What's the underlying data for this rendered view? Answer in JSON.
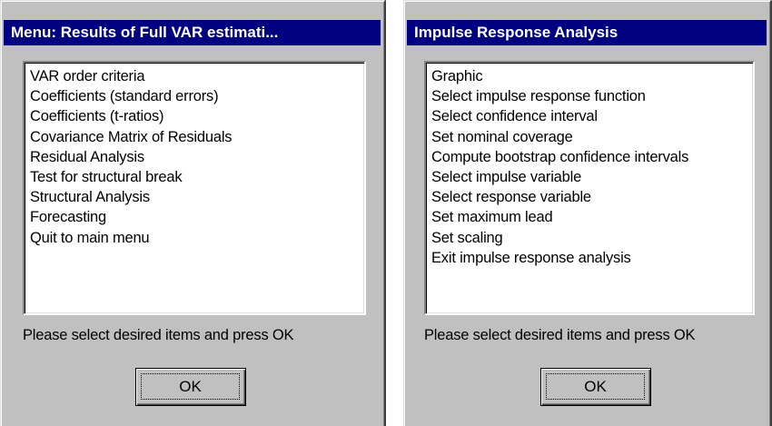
{
  "dialogs": [
    {
      "title": "Menu: Results of Full VAR estimati...",
      "items": [
        "VAR order criteria",
        "Coefficients (standard errors)",
        "Coefficients (t-ratios)",
        "Covariance Matrix of Residuals",
        "Residual Analysis",
        "Test for structural break",
        "Structural Analysis",
        "Forecasting",
        "Quit to main menu"
      ],
      "prompt": "Please select desired items and press OK",
      "ok_label": "OK"
    },
    {
      "title": "Impulse Response Analysis",
      "items": [
        "Graphic",
        "Select impulse response function",
        "Select confidence interval",
        "Set nominal coverage",
        "Compute bootstrap confidence intervals",
        "Select impulse variable",
        "Select response variable",
        "Set maximum lead",
        "Set scaling",
        "Exit impulse response analysis"
      ],
      "prompt": "Please select desired items and press OK",
      "ok_label": "OK"
    }
  ],
  "colors": {
    "titlebar": "#000080",
    "face": "#c0c0c0"
  }
}
